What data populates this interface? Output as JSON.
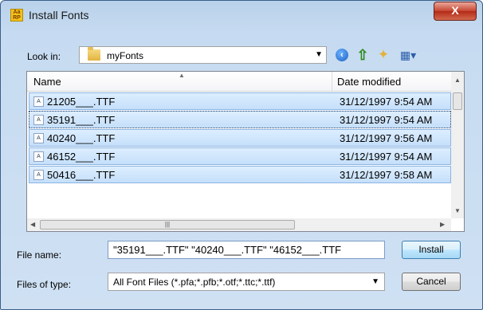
{
  "window": {
    "title": "Install Fonts",
    "close_label": "X"
  },
  "toolbar": {
    "lookin_label": "Look in:",
    "lookin_value": "myFonts",
    "icons": [
      "back-icon",
      "up-folder-icon",
      "new-folder-icon",
      "views-menu-icon"
    ]
  },
  "list": {
    "headers": {
      "name": "Name",
      "date": "Date modified"
    },
    "rows": [
      {
        "name": "21205___.TTF",
        "date": "31/12/1997 9:54 AM"
      },
      {
        "name": "35191___.TTF",
        "date": "31/12/1997 9:54 AM"
      },
      {
        "name": "40240___.TTF",
        "date": "31/12/1997 9:56 AM"
      },
      {
        "name": "46152___.TTF",
        "date": "31/12/1997 9:54 AM"
      },
      {
        "name": "50416___.TTF",
        "date": "31/12/1997 9:58 AM"
      }
    ]
  },
  "form": {
    "filename_label": "File name:",
    "filename_value": "\"35191___.TTF\" \"40240___.TTF\" \"46152___.TTF",
    "filetype_label": "Files of type:",
    "filetype_value": "All Font Files (*.pfa;*.pfb;*.otf;*.ttc;*.ttf)"
  },
  "buttons": {
    "install": "Install",
    "cancel": "Cancel"
  },
  "colors": {
    "selection": "#cce4fb",
    "title_bar": "#b9d1ea",
    "close": "#c6452f"
  }
}
